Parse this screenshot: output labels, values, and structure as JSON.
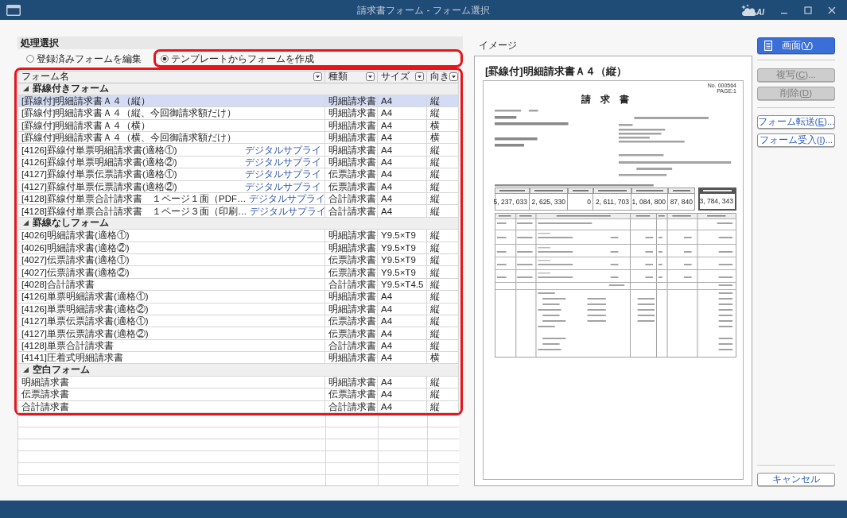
{
  "window": {
    "title": "請求書フォーム - フォーム選択",
    "logo_text": "AI"
  },
  "process_selection": {
    "heading": "処理選択",
    "options": [
      {
        "label": "登録済みフォームを編集",
        "selected": false,
        "highlighted": false
      },
      {
        "label": "テンプレートからフォームを作成",
        "selected": true,
        "highlighted": true
      }
    ]
  },
  "form_table": {
    "highlighted": true,
    "columns": [
      "フォーム名",
      "種類",
      "サイズ",
      "向き"
    ],
    "groups": [
      {
        "label": "罫線付きフォーム",
        "expanded": true,
        "rows": [
          {
            "name": "[罫線付]明細請求書Ａ４（縦）",
            "type": "明細請求書",
            "size": "A4",
            "orientation": "縦",
            "selected": true
          },
          {
            "name": "[罫線付]明細請求書Ａ４（縦、今回御請求額だけ）",
            "type": "明細請求書",
            "size": "A4",
            "orientation": "縦",
            "selected": false
          },
          {
            "name": "[罫線付]明細請求書Ａ４（横）",
            "type": "明細請求書",
            "size": "A4",
            "orientation": "横",
            "selected": false
          },
          {
            "name": "[罫線付]明細請求書Ａ４（横、今回御請求額だけ）",
            "type": "明細請求書",
            "size": "A4",
            "orientation": "横",
            "selected": false
          },
          {
            "name": "[4126]罫線付単票明細請求書(適格①)",
            "vendor": "デジタルサプライ",
            "type": "明細請求書",
            "size": "A4",
            "orientation": "縦",
            "selected": false
          },
          {
            "name": "[4126]罫線付単票明細請求書(適格②)",
            "vendor": "デジタルサプライ",
            "type": "明細請求書",
            "size": "A4",
            "orientation": "縦",
            "selected": false
          },
          {
            "name": "[4127]罫線付単票伝票請求書(適格①)",
            "vendor": "デジタルサプライ",
            "type": "伝票請求書",
            "size": "A4",
            "orientation": "縦",
            "selected": false
          },
          {
            "name": "[4127]罫線付単票伝票請求書(適格②)",
            "vendor": "デジタルサプライ",
            "type": "伝票請求書",
            "size": "A4",
            "orientation": "縦",
            "selected": false
          },
          {
            "name": "[4128]罫線付単票合計請求書　１ページ１面（PDF…",
            "vendor": "デジタルサプライ",
            "type": "合計請求書",
            "size": "A4",
            "orientation": "縦",
            "selected": false
          },
          {
            "name": "[4128]罫線付単票合計請求書　１ページ３面（印刷…",
            "vendor": "デジタルサプライ",
            "type": "合計請求書",
            "size": "A4",
            "orientation": "縦",
            "selected": false
          }
        ]
      },
      {
        "label": "罫線なしフォーム",
        "expanded": true,
        "rows": [
          {
            "name": "[4026]明細請求書(適格①)",
            "type": "明細請求書",
            "size": "Y9.5×T9",
            "orientation": "縦",
            "selected": false
          },
          {
            "name": "[4026]明細請求書(適格②)",
            "type": "明細請求書",
            "size": "Y9.5×T9",
            "orientation": "縦",
            "selected": false
          },
          {
            "name": "[4027]伝票請求書(適格①)",
            "type": "伝票請求書",
            "size": "Y9.5×T9",
            "orientation": "縦",
            "selected": false
          },
          {
            "name": "[4027]伝票請求書(適格②)",
            "type": "伝票請求書",
            "size": "Y9.5×T9",
            "orientation": "縦",
            "selected": false
          },
          {
            "name": "[4028]合計請求書",
            "type": "合計請求書",
            "size": "Y9.5×T4.5",
            "orientation": "縦",
            "selected": false
          },
          {
            "name": "[4126]単票明細請求書(適格①)",
            "type": "明細請求書",
            "size": "A4",
            "orientation": "縦",
            "selected": false
          },
          {
            "name": "[4126]単票明細請求書(適格②)",
            "type": "明細請求書",
            "size": "A4",
            "orientation": "縦",
            "selected": false
          },
          {
            "name": "[4127]単票伝票請求書(適格①)",
            "type": "伝票請求書",
            "size": "A4",
            "orientation": "縦",
            "selected": false
          },
          {
            "name": "[4127]単票伝票請求書(適格②)",
            "type": "伝票請求書",
            "size": "A4",
            "orientation": "縦",
            "selected": false
          },
          {
            "name": "[4128]単票合計請求書",
            "type": "合計請求書",
            "size": "A4",
            "orientation": "縦",
            "selected": false
          },
          {
            "name": "[4141]圧着式明細請求書",
            "type": "明細請求書",
            "size": "A4",
            "orientation": "横",
            "selected": false
          }
        ]
      },
      {
        "label": "空白フォーム",
        "expanded": true,
        "rows": [
          {
            "name": "明細請求書",
            "type": "明細請求書",
            "size": "A4",
            "orientation": "縦",
            "selected": false
          },
          {
            "name": "伝票請求書",
            "type": "伝票請求書",
            "size": "A4",
            "orientation": "縦",
            "selected": false
          },
          {
            "name": "合計請求書",
            "type": "合計請求書",
            "size": "A4",
            "orientation": "縦",
            "selected": false
          }
        ]
      }
    ]
  },
  "preview": {
    "label": "イメージ",
    "title": "[罫線付]明細請求書Ａ４（縦）",
    "document": {
      "number": "No. 000564",
      "page": "PAGE:1",
      "heading": "請　求　書",
      "summary_amounts": [
        "5, 237, 033",
        "2, 625, 330",
        "0",
        "2, 611, 703",
        "1, 084, 800",
        "87, 840",
        "3, 784, 343"
      ]
    }
  },
  "button_groups": [
    [
      {
        "label": "画面(",
        "key": "V",
        "suffix": ")",
        "kind": "primary",
        "disabled": false
      }
    ],
    [
      {
        "label": "複写(",
        "key": "C",
        "suffix": ")...",
        "kind": "default",
        "disabled": true
      },
      {
        "label": "削除(",
        "key": "D",
        "suffix": ")",
        "kind": "default",
        "disabled": true
      }
    ],
    [
      {
        "label": "フォーム転送(",
        "key": "E",
        "suffix": ")...",
        "kind": "default",
        "disabled": false
      },
      {
        "label": "フォーム受入(",
        "key": "I",
        "suffix": ")...",
        "kind": "default",
        "disabled": false
      }
    ]
  ],
  "footer_buttons": [
    {
      "label": "キャンセル",
      "kind": "default",
      "disabled": false
    }
  ]
}
